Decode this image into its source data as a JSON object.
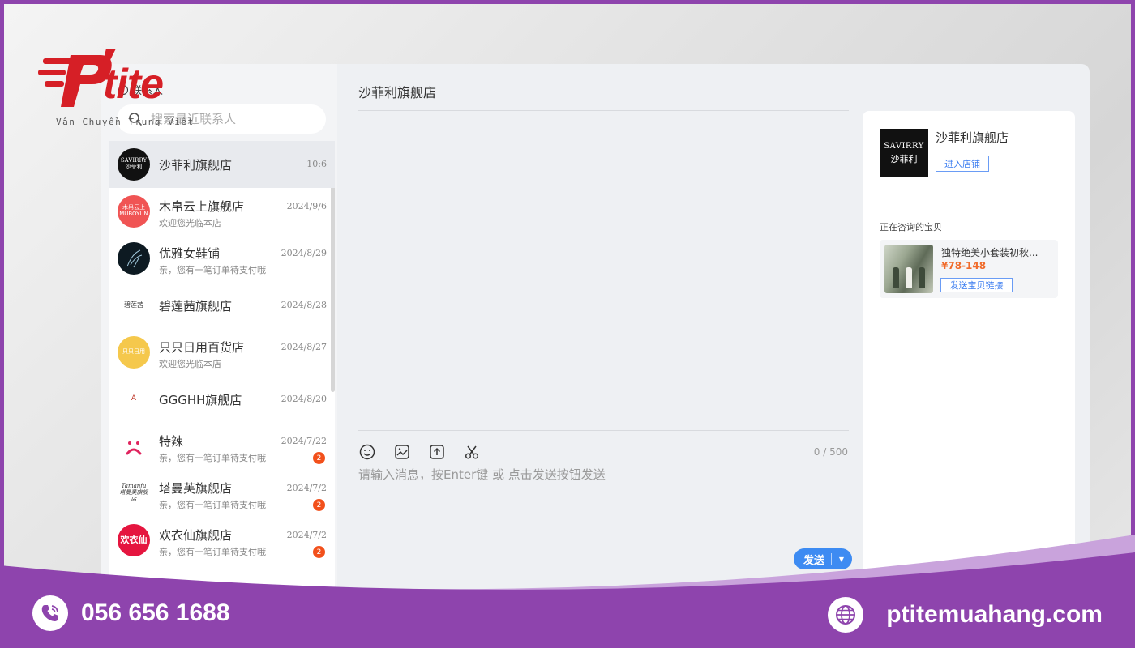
{
  "logo": {
    "brand": "tite",
    "tagline": "Vận Chuyển Trung Việt",
    "color": "#d61f26"
  },
  "sidebar": {
    "header_label": "联系人",
    "search_placeholder": "搜索最近联系人",
    "conversations": [
      {
        "name": "沙菲利旗舰店",
        "date": "10:6",
        "message": "",
        "badge": "",
        "avatar_text": "SAVIRRY 沙菲利",
        "avatar_color": "#111111",
        "active": true
      },
      {
        "name": "木帛云上旗舰店",
        "date": "2024/9/6",
        "message": "欢迎您光临本店",
        "badge": "",
        "avatar_text": "木帛云上",
        "avatar_color": "#f05454",
        "active": false
      },
      {
        "name": "优雅女鞋铺",
        "date": "2024/8/29",
        "message": "亲，您有一笔订单待支付哦",
        "badge": "",
        "avatar_text": "",
        "avatar_color": "#0d1a22",
        "active": false
      },
      {
        "name": "碧莲茜旗舰店",
        "date": "2024/8/28",
        "message": "",
        "badge": "",
        "avatar_text": "碧莲茜",
        "avatar_color": "#ffffff",
        "active": false
      },
      {
        "name": "只只日用百货店",
        "date": "2024/8/27",
        "message": "欢迎您光临本店",
        "badge": "",
        "avatar_text": "只只日用",
        "avatar_color": "#f5c84c",
        "active": false
      },
      {
        "name": "GGGHH旗舰店",
        "date": "2024/8/20",
        "message": "",
        "badge": "",
        "avatar_text": "A",
        "avatar_color": "#ffffff",
        "active": false
      },
      {
        "name": "特辣",
        "date": "2024/7/22",
        "message": "亲，您有一笔订单待支付哦",
        "badge": "2",
        "avatar_text": "",
        "avatar_color": "#ffffff",
        "active": false
      },
      {
        "name": "塔曼芙旗舰店",
        "date": "2024/7/2",
        "message": "亲，您有一笔订单待支付哦",
        "badge": "2",
        "avatar_text": "Tamanfu 塔曼芙旗舰店",
        "avatar_color": "#ffffff",
        "active": false
      },
      {
        "name": "欢衣仙旗舰店",
        "date": "2024/7/2",
        "message": "亲，您有一笔订单待支付哦",
        "badge": "2",
        "avatar_text": "欢衣仙",
        "avatar_color": "#e5153f",
        "active": false
      }
    ]
  },
  "chat": {
    "title": "沙菲利旗舰店",
    "counter": "0 / 500",
    "input_placeholder": "请输入消息，按Enter键 或 点击发送按钮发送",
    "send_label": "发送",
    "tools": [
      "emoji-icon",
      "image-icon",
      "upload-icon",
      "scissors-icon"
    ]
  },
  "panel": {
    "shop_logo_line1": "SAVIRRY",
    "shop_logo_line2": "沙菲利",
    "shop_name": "沙菲利旗舰店",
    "enter_shop_label": "进入店铺",
    "consulting_label": "正在咨询的宝贝",
    "product_name": "独特绝美小套装初秋...",
    "product_price": "¥78-148",
    "send_link_label": "发送宝贝链接"
  },
  "footer": {
    "phone": "056 656 1688",
    "website": "ptitemuahang.com",
    "color": "#8e44ad"
  }
}
